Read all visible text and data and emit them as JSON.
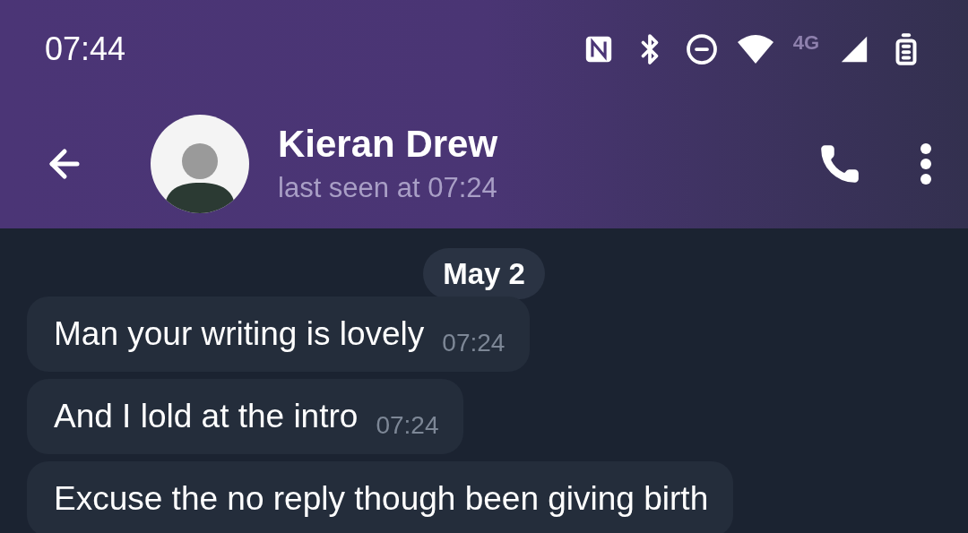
{
  "status_bar": {
    "time": "07:44",
    "network": "4G"
  },
  "header": {
    "name": "Kieran Drew",
    "status": "last seen at 07:24"
  },
  "date_label": "May 2",
  "messages": [
    {
      "text": "Man your writing is lovely",
      "time": "07:24"
    },
    {
      "text": "And I lold at the intro",
      "time": "07:24"
    },
    {
      "text": "Excuse the no reply though been giving birth"
    }
  ]
}
